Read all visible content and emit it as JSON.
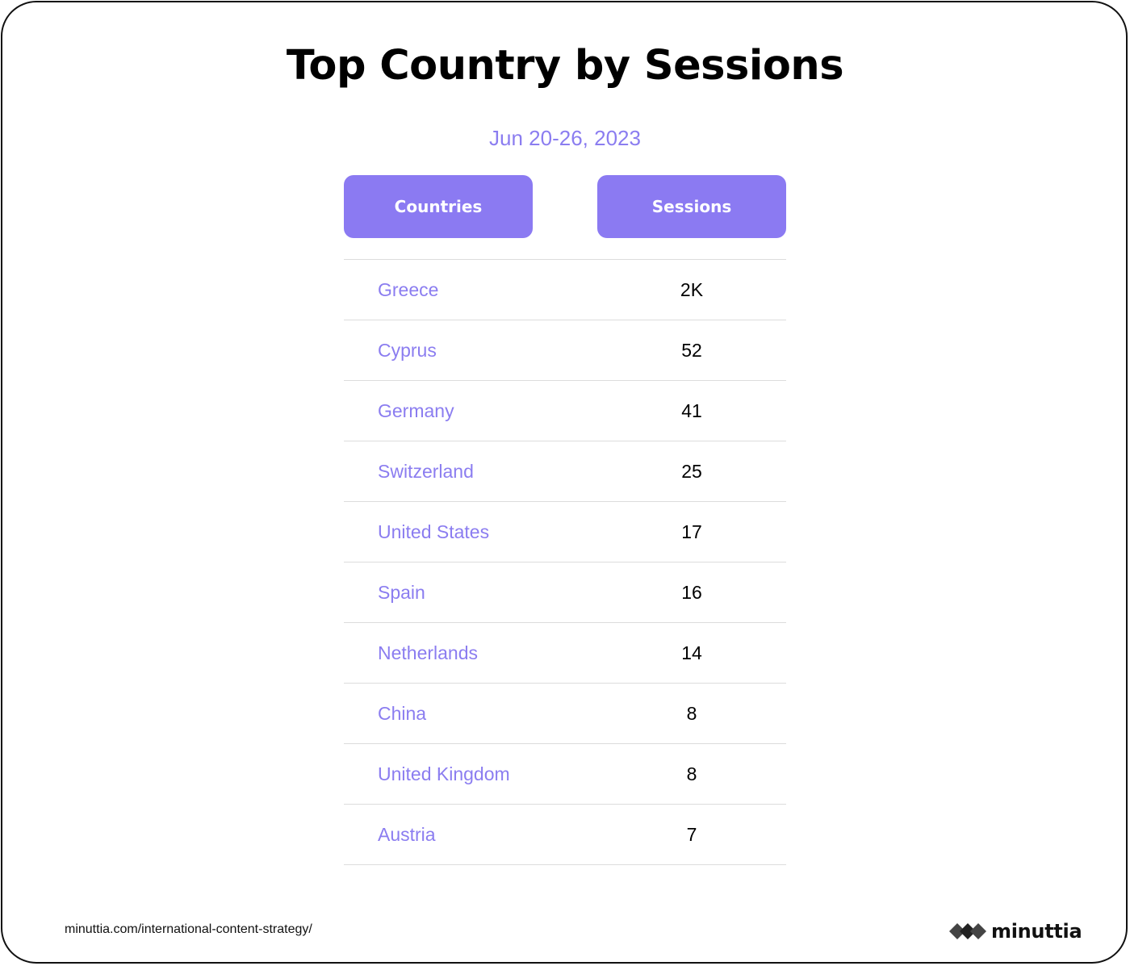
{
  "title": "Top Country by Sessions",
  "subtitle": "Jun 20-26, 2023",
  "colors": {
    "accent": "#8b7af2",
    "country_text": "#8b7df0",
    "value_text": "#000000"
  },
  "chart_data": {
    "type": "table",
    "title": "Top Country by Sessions",
    "subtitle": "Jun 20-26, 2023",
    "columns": [
      "Countries",
      "Sessions"
    ],
    "rows": [
      {
        "country": "Greece",
        "sessions": "2K"
      },
      {
        "country": "Cyprus",
        "sessions": "52"
      },
      {
        "country": "Germany",
        "sessions": "41"
      },
      {
        "country": "Switzerland",
        "sessions": "25"
      },
      {
        "country": "United States",
        "sessions": "17"
      },
      {
        "country": "Spain",
        "sessions": "16"
      },
      {
        "country": "Netherlands",
        "sessions": "14"
      },
      {
        "country": "China",
        "sessions": "8"
      },
      {
        "country": "United Kingdom",
        "sessions": "8"
      },
      {
        "country": "Austria",
        "sessions": "7"
      }
    ]
  },
  "footer": {
    "url": "minuttia.com/international-content-strategy/"
  },
  "logo": {
    "text": "minuttia",
    "icon": "diamonds-logo-icon"
  }
}
